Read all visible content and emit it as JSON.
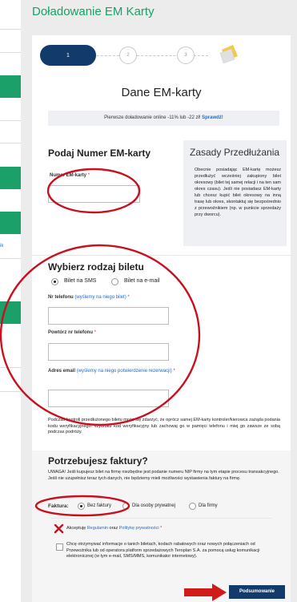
{
  "page": {
    "title": "Doładowanie EM Karty"
  },
  "sidebar": {
    "link_fragment": "ik"
  },
  "stepper": {
    "steps": [
      "1",
      "2",
      "3"
    ]
  },
  "section": {
    "title": "Dane EM-karty"
  },
  "promo": {
    "text": "Pierwsze doładowanie online -11% lub -22 zł!",
    "link": "Sprawdź!"
  },
  "card": {
    "heading": "Podaj Numer EM-karty",
    "field_label": "Numer EM-karty",
    "required": "*"
  },
  "renewal": {
    "title": "Zasady Przedłużania",
    "text": "Obecnie posiadając EM-kartę możesz przedłużyć wcześniej zakupiony bilet okresowy (bilet tej samej relacji i na ten sam okres czasu). Jeśli nie posiadasz EM-karty lub chcesz kupić bilet okresowy na inną trasę lub okres, skontaktuj się bezpośrednio z przewoźnikiem (np. w punkcie sprzedaży przy dworcu)."
  },
  "ticket": {
    "heading": "Wybierz rodzaj biletu",
    "option_sms": "Bilet na SMS",
    "option_email": "Bilet na e-mail",
    "phone_label": "Nr telefonu",
    "phone_hint": "(wyślemy na niego bilet)",
    "phone_repeat_label": "Powtórz nr telefonu",
    "email_label": "Adres email",
    "email_hint": "(wyślemy na niego potwierdzenie rezerwacji)",
    "required": "*"
  },
  "control_note": "Podczas kontroli przedłużonego biletu może się zdarzyć, że oprócz samej EM-karty kontroler/kierowca zażąda podania kodu weryfikacyjnego. Wydruku kod weryfikacyjny lub zachowaj go w pamięci telefonu i miej go zawsze ze sobą podczas podróży.",
  "invoice": {
    "heading": "Potrzebujesz faktury?",
    "warning": "UWAGA! Jeśli kupujesz bilet na firmę niezbędne jest podanie numeru NIP firmy na tym etapie procesu transakcyjnego. Jeśli nie uzupełnisz teraz tych danych, nie będziemy mieli możliwości wystawienia faktury na firmę.",
    "label": "Faktura:",
    "options": [
      "Bez faktury",
      "Dla osoby prywatnej",
      "Dla firmy"
    ]
  },
  "consent": {
    "accept_prefix": "Akceptuję",
    "terms_link": "Regulamin",
    "and": "oraz",
    "privacy_link": "Politykę prywatności",
    "required": "*",
    "marketing": "Chcę otrzymywać informacje o tanich biletach, kodach rabatowych oraz nowych połączeniach od Przewoźnika lub od operatora platform sprzedażowych Teroplan S.A. za pomocą usług komunikacji elektronicznej (w tym e-mail, SMS/MMS, komunikator internetowy)."
  },
  "actions": {
    "submit": "Podsumowanie"
  },
  "colors": {
    "brand_green": "#1aa068",
    "navy": "#123a6b",
    "annotation_red": "#c8101e",
    "link_blue": "#1a6ec9"
  }
}
